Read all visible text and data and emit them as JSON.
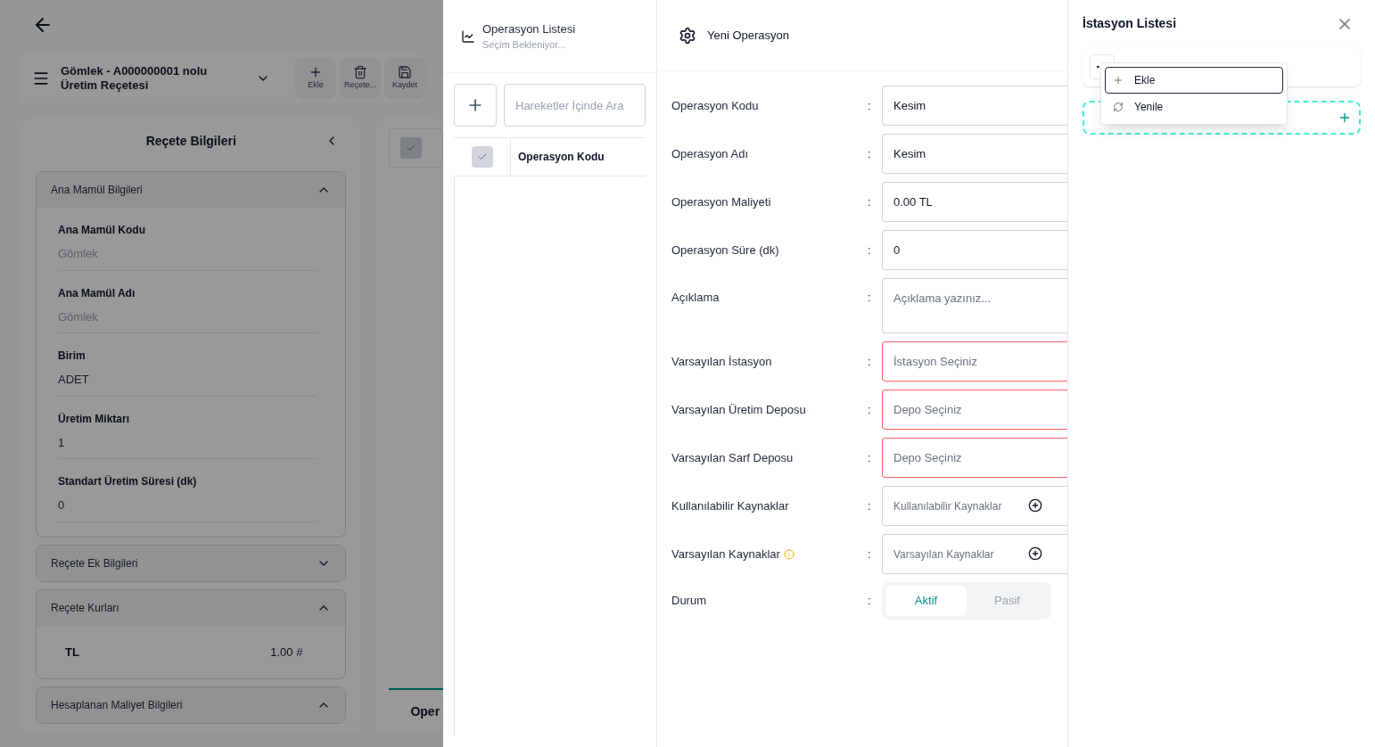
{
  "background": {
    "title": "Gömlek - A000000001 nolu Üretim Reçetesi",
    "toolbar": [
      {
        "label": "Ekle",
        "kind": "plus"
      },
      {
        "label": "Reçete...",
        "kind": "trash"
      },
      {
        "label": "Kaydet",
        "kind": "save"
      }
    ],
    "panel_title": "Reçete Bilgileri",
    "sections": [
      {
        "title": "Ana Mamül Bilgileri",
        "expanded": true,
        "fields": [
          {
            "label": "Ana Mamül Kodu",
            "value": "Gömlek",
            "muted": true
          },
          {
            "label": "Ana Mamül Adı",
            "value": "Gömlek",
            "muted": true
          },
          {
            "label": "Birim",
            "value": "ADET",
            "muted": false
          },
          {
            "label": "Üretim Miktarı",
            "value": "1",
            "muted": false
          },
          {
            "label": "Standart Üretim Süresi (dk)",
            "value": "0",
            "muted": false
          }
        ]
      },
      {
        "title": "Reçete Ek Bilgileri",
        "expanded": false
      },
      {
        "title": "Reçete Kurları",
        "expanded": true,
        "rates": [
          {
            "currency": "TL",
            "value": "1.00 #"
          }
        ]
      },
      {
        "title": "Hesaplanan Maliyet Bilgileri",
        "expanded": true
      }
    ],
    "side_card_checkbox": {
      "checked": true
    },
    "side_tab": "Oper"
  },
  "operation_list": {
    "title": "Operasyon Listesi",
    "subtitle": "Seçim Bekleniyor...",
    "search": {
      "placeholder": "Hareketler İçinde Ara"
    },
    "columns": [
      "Operasyon Kodu"
    ],
    "select_all": {
      "checked": true
    }
  },
  "new_operation": {
    "title": "Yeni Operasyon",
    "separator": ":",
    "fields": [
      {
        "label": "Operasyon Kodu",
        "kind": "input",
        "value": "Kesim",
        "invalid": false
      },
      {
        "label": "Operasyon Adı",
        "kind": "input",
        "value": "Kesim",
        "invalid": false
      },
      {
        "label": "Operasyon Maliyeti",
        "kind": "input",
        "value": "0.00 TL",
        "invalid": false
      },
      {
        "label": "Operasyon Süre (dk)",
        "kind": "input",
        "value": "0",
        "invalid": false
      },
      {
        "label": "Açıklama",
        "kind": "textarea",
        "placeholder": "Açıklama yazınız...",
        "invalid": false
      },
      {
        "label": "Varsayılan İstasyon",
        "kind": "input",
        "placeholder": "İstasyon Seçiniz",
        "invalid": true
      },
      {
        "label": "Varsayılan Üretim Deposu",
        "kind": "input",
        "placeholder": "Depo Seçiniz",
        "invalid": true
      },
      {
        "label": "Varsayılan Sarf Deposu",
        "kind": "input",
        "placeholder": "Depo Seçiniz",
        "invalid": true
      },
      {
        "label": "Kullanılabilir Kaynaklar",
        "kind": "resource",
        "placeholder": "Kullanılabilir Kaynaklar",
        "invalid": false
      },
      {
        "label": "Varsayılan Kaynaklar",
        "kind": "resource",
        "placeholder": "Varsayılan Kaynaklar",
        "invalid": false,
        "info": true
      },
      {
        "label": "Durum",
        "kind": "toggle",
        "options": [
          {
            "label": "Aktif",
            "selected": true
          },
          {
            "label": "Pasif",
            "selected": false
          }
        ]
      }
    ]
  },
  "station_list": {
    "title": "İstasyon Listesi",
    "menu": [
      {
        "label": "Ekle",
        "kind": "plus",
        "selected": true
      },
      {
        "label": "Yenile",
        "kind": "refresh",
        "selected": false
      }
    ]
  }
}
